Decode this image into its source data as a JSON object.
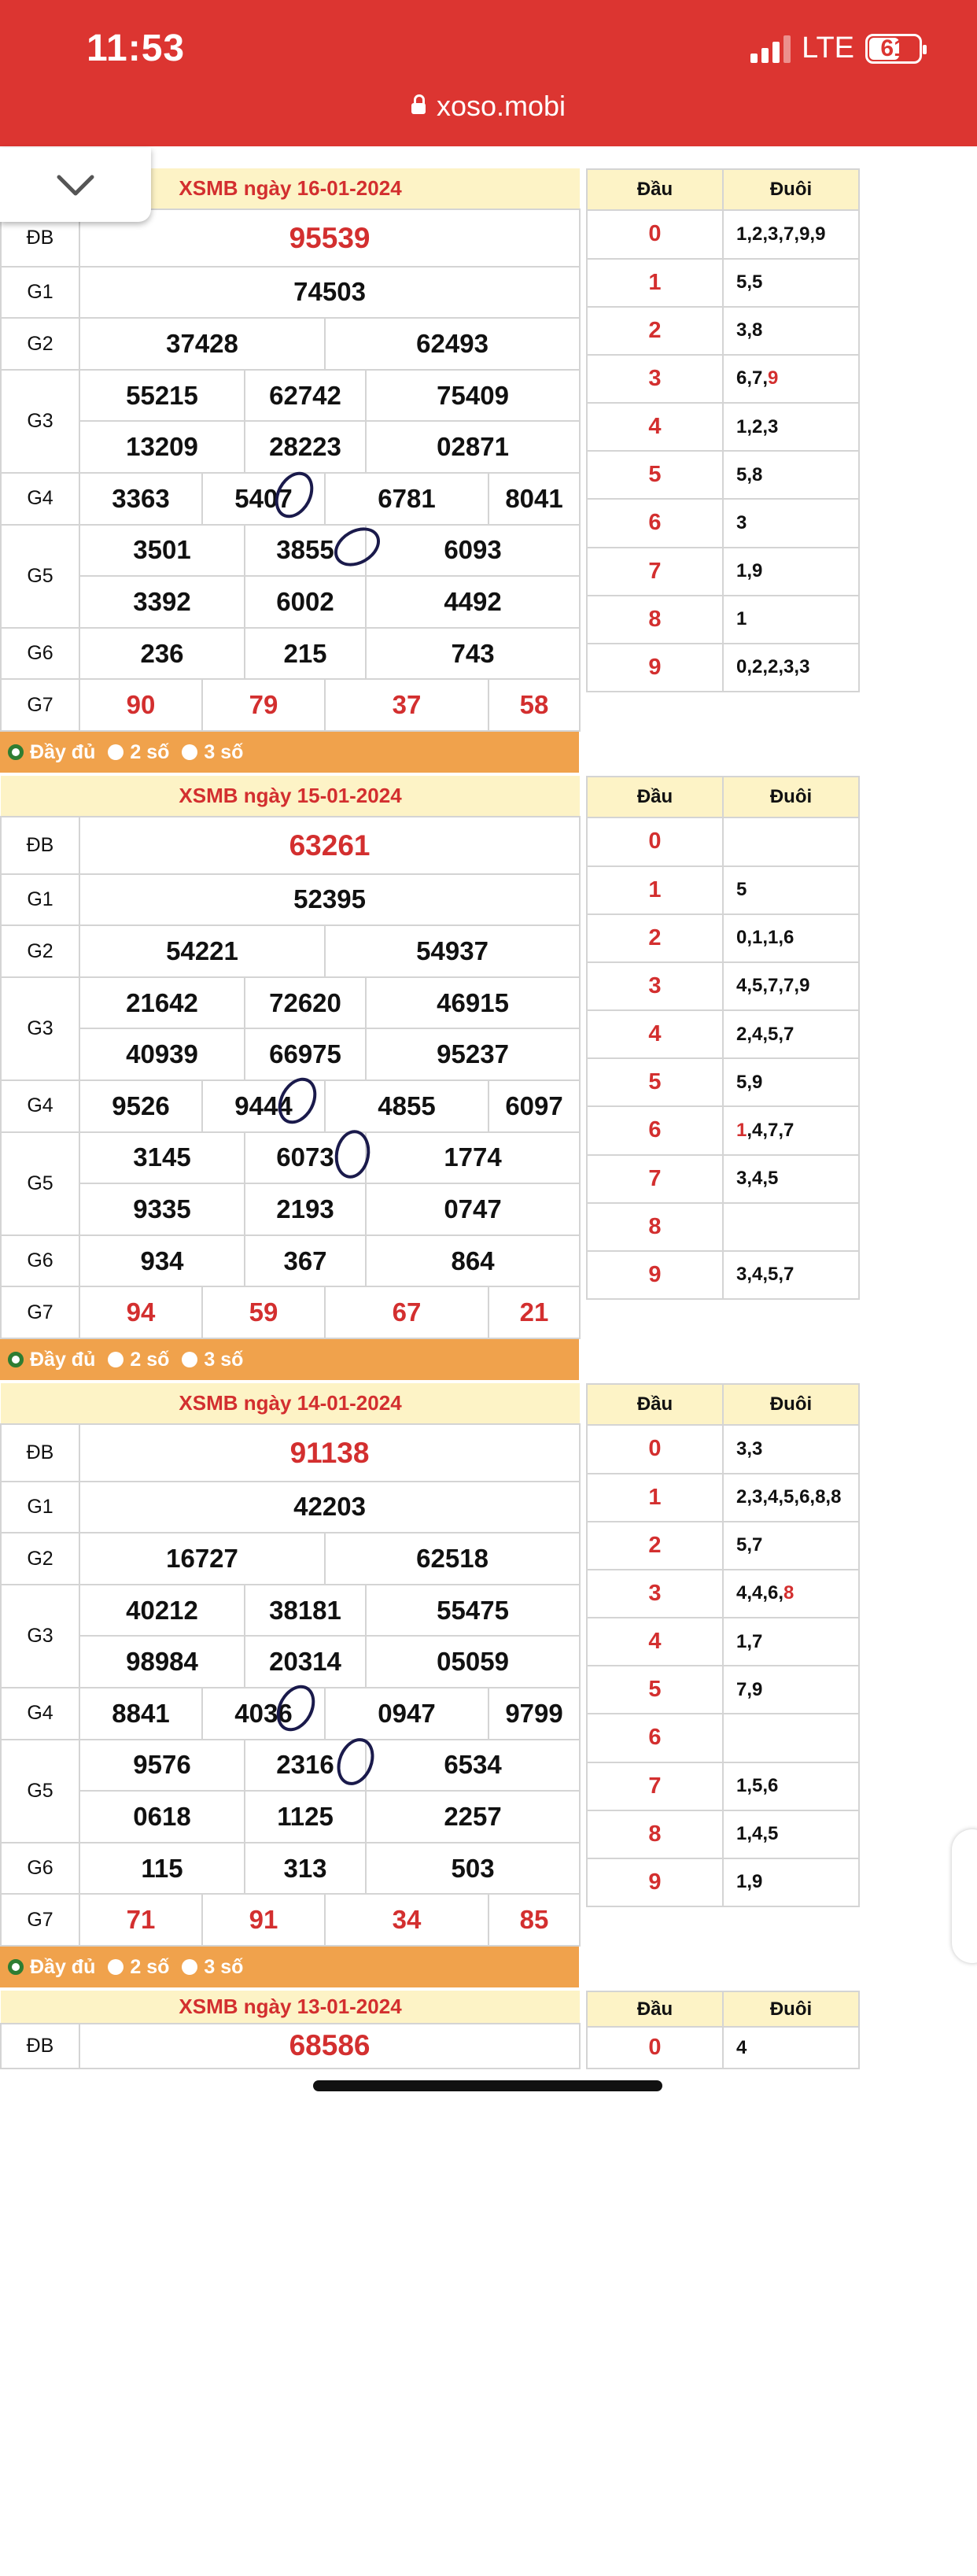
{
  "status_bar": {
    "time": "11:53",
    "network": "LTE",
    "battery": "61"
  },
  "browser": {
    "url": "xoso.mobi"
  },
  "side_header": {
    "dau": "Đầu",
    "duoi": "Đuôi"
  },
  "options": {
    "full": "Đầy đủ",
    "two": "2 số",
    "three": "3 số"
  },
  "labels": {
    "db": "ĐB",
    "g1": "G1",
    "g2": "G2",
    "g3": "G3",
    "g4": "G4",
    "g5": "G5",
    "g6": "G6",
    "g7": "G7"
  },
  "days": [
    {
      "title": "XSMB ngày 16-01-2024",
      "db": "95539",
      "g1": "74503",
      "g2": [
        "37428",
        "62493"
      ],
      "g3": [
        "55215",
        "62742",
        "75409",
        "13209",
        "28223",
        "02871"
      ],
      "g4": [
        "3363",
        "5407",
        "6781",
        "8041"
      ],
      "g5": [
        "3501",
        "3855",
        "6093",
        "3392",
        "6002",
        "4492"
      ],
      "g6": [
        "236",
        "215",
        "743"
      ],
      "g7": [
        "90",
        "79",
        "37",
        "58"
      ],
      "loto": [
        {
          "dau": "0",
          "duoi": [
            {
              "t": "1,2,3,7,9,9"
            }
          ]
        },
        {
          "dau": "1",
          "duoi": [
            {
              "t": "5,5"
            }
          ]
        },
        {
          "dau": "2",
          "duoi": [
            {
              "t": "3,8"
            }
          ]
        },
        {
          "dau": "3",
          "duoi": [
            {
              "t": "6,7,"
            },
            {
              "t": "9",
              "r": true
            }
          ]
        },
        {
          "dau": "4",
          "duoi": [
            {
              "t": "1,2,3"
            }
          ]
        },
        {
          "dau": "5",
          "duoi": [
            {
              "t": "5,8"
            }
          ]
        },
        {
          "dau": "6",
          "duoi": [
            {
              "t": "3"
            }
          ]
        },
        {
          "dau": "7",
          "duoi": [
            {
              "t": "1,9"
            }
          ]
        },
        {
          "dau": "8",
          "duoi": [
            {
              "t": "1"
            }
          ]
        },
        {
          "dau": "9",
          "duoi": [
            {
              "t": "0,2,2,3,3"
            }
          ]
        }
      ]
    },
    {
      "title": "XSMB ngày 15-01-2024",
      "db": "63261",
      "g1": "52395",
      "g2": [
        "54221",
        "54937"
      ],
      "g3": [
        "21642",
        "72620",
        "46915",
        "40939",
        "66975",
        "95237"
      ],
      "g4": [
        "9526",
        "9444",
        "4855",
        "6097"
      ],
      "g5": [
        "3145",
        "6073",
        "1774",
        "9335",
        "2193",
        "0747"
      ],
      "g6": [
        "934",
        "367",
        "864"
      ],
      "g7": [
        "94",
        "59",
        "67",
        "21"
      ],
      "loto": [
        {
          "dau": "0",
          "duoi": []
        },
        {
          "dau": "1",
          "duoi": [
            {
              "t": "5"
            }
          ]
        },
        {
          "dau": "2",
          "duoi": [
            {
              "t": "0,1,1,6"
            }
          ]
        },
        {
          "dau": "3",
          "duoi": [
            {
              "t": "4,5,7,7,9"
            }
          ]
        },
        {
          "dau": "4",
          "duoi": [
            {
              "t": "2,4,5,7"
            }
          ]
        },
        {
          "dau": "5",
          "duoi": [
            {
              "t": "5,9"
            }
          ]
        },
        {
          "dau": "6",
          "duoi": [
            {
              "t": "1",
              "r": true
            },
            {
              "t": ",4,7,7"
            }
          ]
        },
        {
          "dau": "7",
          "duoi": [
            {
              "t": "3,4,5"
            }
          ]
        },
        {
          "dau": "8",
          "duoi": []
        },
        {
          "dau": "9",
          "duoi": [
            {
              "t": "3,4,5,7"
            }
          ]
        }
      ]
    },
    {
      "title": "XSMB ngày 14-01-2024",
      "db": "91138",
      "g1": "42203",
      "g2": [
        "16727",
        "62518"
      ],
      "g3": [
        "40212",
        "38181",
        "55475",
        "98984",
        "20314",
        "05059"
      ],
      "g4": [
        "8841",
        "4036",
        "0947",
        "9799"
      ],
      "g5": [
        "9576",
        "2316",
        "6534",
        "0618",
        "1125",
        "2257"
      ],
      "g6": [
        "115",
        "313",
        "503"
      ],
      "g7": [
        "71",
        "91",
        "34",
        "85"
      ],
      "loto": [
        {
          "dau": "0",
          "duoi": [
            {
              "t": "3,3"
            }
          ]
        },
        {
          "dau": "1",
          "duoi": [
            {
              "t": "2,3,4,5,6,8,8"
            }
          ]
        },
        {
          "dau": "2",
          "duoi": [
            {
              "t": "5,7"
            }
          ]
        },
        {
          "dau": "3",
          "duoi": [
            {
              "t": "4,4,6,"
            },
            {
              "t": "8",
              "r": true
            }
          ]
        },
        {
          "dau": "4",
          "duoi": [
            {
              "t": "1,7"
            }
          ]
        },
        {
          "dau": "5",
          "duoi": [
            {
              "t": "7,9"
            }
          ]
        },
        {
          "dau": "6",
          "duoi": []
        },
        {
          "dau": "7",
          "duoi": [
            {
              "t": "1,5,6"
            }
          ]
        },
        {
          "dau": "8",
          "duoi": [
            {
              "t": "1,4,5"
            }
          ]
        },
        {
          "dau": "9",
          "duoi": [
            {
              "t": "1,9"
            }
          ]
        }
      ]
    },
    {
      "title": "XSMB ngày 13-01-2024",
      "db": "68586",
      "g1": "",
      "g2": [],
      "g3": [],
      "g4": [],
      "g5": [],
      "g6": [],
      "g7": [],
      "loto": [
        {
          "dau": "0",
          "duoi": [
            {
              "t": "4"
            }
          ]
        }
      ]
    }
  ]
}
